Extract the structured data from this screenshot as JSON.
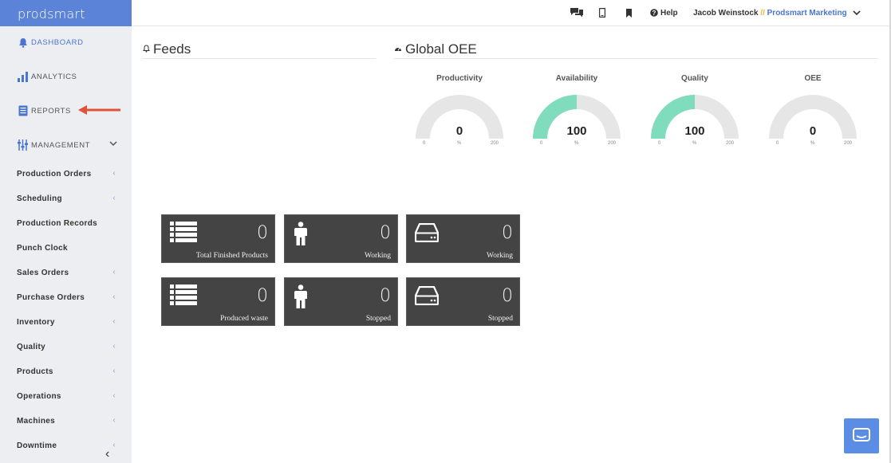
{
  "brand": "prodsmart",
  "nav_main": [
    {
      "label": "DASHBOARD",
      "icon": "bell-icon",
      "active": true
    },
    {
      "label": "ANALYTICS",
      "icon": "bar-chart-icon"
    },
    {
      "label": "REPORTS",
      "icon": "document-icon"
    },
    {
      "label": "MANAGEMENT",
      "icon": "sliders-icon"
    }
  ],
  "nav_sub": [
    {
      "label": "Production Orders",
      "chev": "‹"
    },
    {
      "label": "Scheduling",
      "chev": "‹"
    },
    {
      "label": "Production Records",
      "chev": ""
    },
    {
      "label": "Punch Clock",
      "chev": ""
    },
    {
      "label": "Sales Orders",
      "chev": "‹"
    },
    {
      "label": "Purchase Orders",
      "chev": "‹"
    },
    {
      "label": "Inventory",
      "chev": "‹"
    },
    {
      "label": "Quality",
      "chev": "‹"
    },
    {
      "label": "Products",
      "chev": "‹"
    },
    {
      "label": "Operations",
      "chev": "‹"
    },
    {
      "label": "Machines",
      "chev": "‹"
    },
    {
      "label": "Downtime",
      "chev": "‹"
    }
  ],
  "collapse_glyph": "‹",
  "topbar": {
    "help_label": "Help",
    "user_name": "Jacob Weinstock",
    "separator": "//",
    "org_name": "Prodsmart Marketing"
  },
  "feeds": {
    "title": "Feeds"
  },
  "oee": {
    "title": "Global OEE",
    "gauges": [
      {
        "label": "Productivity",
        "value": "0",
        "fill": 0,
        "min": "0",
        "unit": "%",
        "max": "200"
      },
      {
        "label": "Availability",
        "value": "100",
        "fill": 0.5,
        "min": "0",
        "unit": "%",
        "max": "200"
      },
      {
        "label": "Quality",
        "value": "100",
        "fill": 0.5,
        "min": "0",
        "unit": "%",
        "max": "200"
      },
      {
        "label": "OEE",
        "value": "0",
        "fill": 0,
        "min": "0",
        "unit": "%",
        "max": "200"
      }
    ]
  },
  "tiles": [
    {
      "value": "0",
      "caption": "Total Finished Products",
      "icon": "list-icon"
    },
    {
      "value": "0",
      "caption": "Working",
      "icon": "person-icon"
    },
    {
      "value": "0",
      "caption": "Working",
      "icon": "hard-drive-icon"
    },
    {
      "value": "0",
      "caption": "Produced waste",
      "icon": "list-icon"
    },
    {
      "value": "0",
      "caption": "Stopped",
      "icon": "person-icon"
    },
    {
      "value": "0",
      "caption": "Stopped",
      "icon": "hard-drive-icon"
    }
  ],
  "colors": {
    "brand_blue": "#5b83d8",
    "gauge_fill": "#7fdcbc",
    "gauge_track": "#e6e6e6",
    "tile_bg": "#444444",
    "annotation_arrow": "#e0533a"
  }
}
